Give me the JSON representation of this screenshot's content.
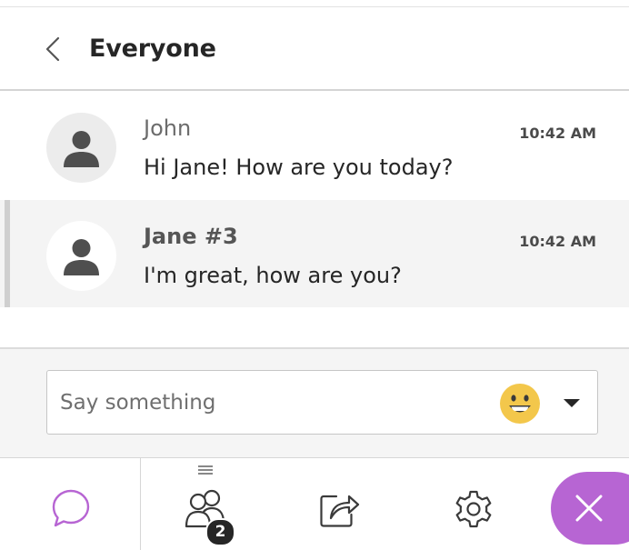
{
  "header": {
    "title": "Everyone"
  },
  "messages": [
    {
      "sender": "John",
      "text": "Hi Jane! How are you today?",
      "time": "10:42 AM"
    },
    {
      "sender": "Jane #3",
      "text": "I'm great, how are you?",
      "time": "10:42 AM"
    }
  ],
  "composer": {
    "placeholder": "Say something",
    "value": ""
  },
  "bottom_nav": {
    "attendee_count": "2"
  },
  "colors": {
    "accent": "#b765d3",
    "highlight_bg": "#f4f4f4"
  },
  "icons": {
    "back": "chevron-left-icon",
    "avatar": "user-icon",
    "emoji": "smiley-face-icon",
    "dropdown": "caret-down-icon",
    "chat": "chat-bubble-icon",
    "attendees": "people-icon",
    "share": "share-icon",
    "settings": "gear-icon",
    "close": "close-icon"
  }
}
